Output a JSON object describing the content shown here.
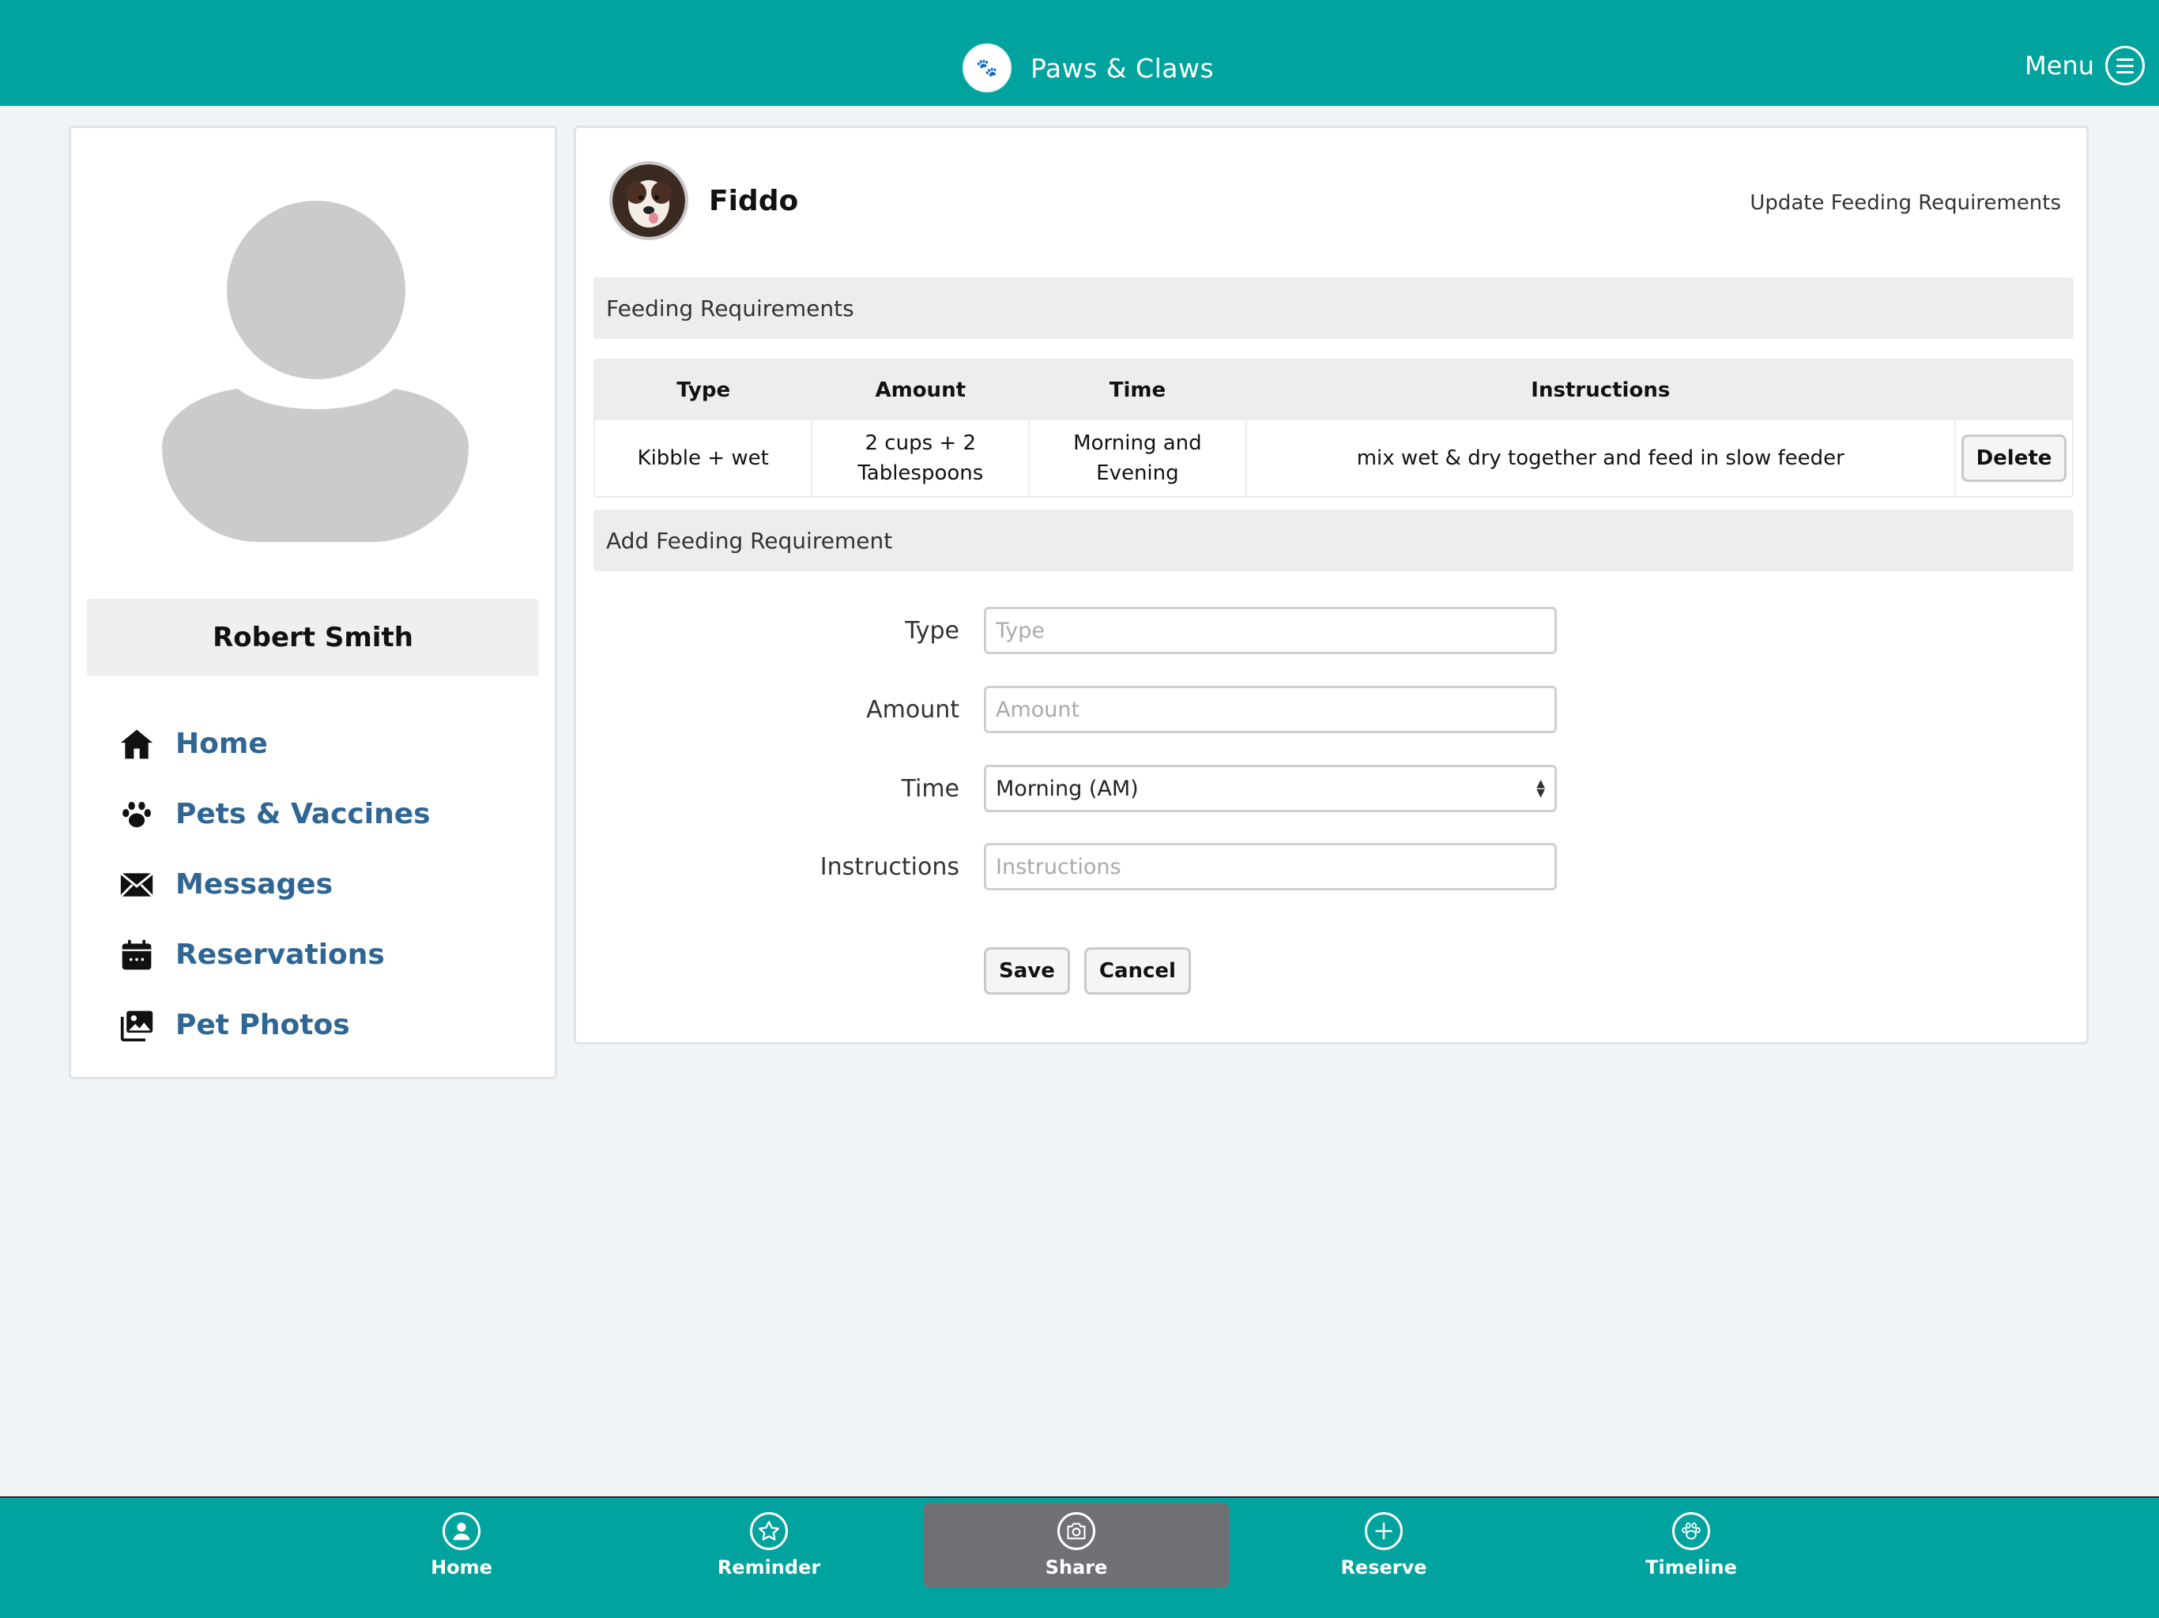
{
  "header": {
    "app_name": "Paws & Claws",
    "logo_text": "🐾",
    "menu_label": "Menu"
  },
  "sidebar": {
    "user_name": "Robert Smith",
    "items": [
      {
        "label": "Home",
        "icon": "home-icon"
      },
      {
        "label": "Pets & Vaccines",
        "icon": "paw-icon"
      },
      {
        "label": "Messages",
        "icon": "envelope-icon"
      },
      {
        "label": "Reservations",
        "icon": "calendar-icon"
      },
      {
        "label": "Pet Photos",
        "icon": "photos-icon"
      }
    ]
  },
  "main": {
    "pet_name": "Fiddo",
    "update_link": "Update Feeding Requirements",
    "feeding_section_title": "Feeding Requirements",
    "table": {
      "headers": [
        "Type",
        "Amount",
        "Time",
        "Instructions"
      ],
      "rows": [
        {
          "type": "Kibble + wet",
          "amount": "2 cups + 2 Tablespoons",
          "time": "Morning and Evening",
          "instructions": "mix wet & dry together and feed in slow feeder",
          "action": "Delete"
        }
      ]
    },
    "add_section_title": "Add Feeding Requirement",
    "form": {
      "type_label": "Type",
      "type_placeholder": "Type",
      "amount_label": "Amount",
      "amount_placeholder": "Amount",
      "time_label": "Time",
      "time_value": "Morning (AM)",
      "instructions_label": "Instructions",
      "instructions_placeholder": "Instructions",
      "save_label": "Save",
      "cancel_label": "Cancel"
    }
  },
  "bottom_nav": [
    {
      "label": "Home",
      "icon": "user-circle-icon"
    },
    {
      "label": "Reminder",
      "icon": "star-icon"
    },
    {
      "label": "Share",
      "icon": "camera-icon",
      "active": true
    },
    {
      "label": "Reserve",
      "icon": "plus-icon"
    },
    {
      "label": "Timeline",
      "icon": "paw-icon"
    }
  ],
  "colors": {
    "brand": "#00a39e",
    "link": "#2f6694",
    "page_bg": "#f1f4f6",
    "active_tab": "#6f7175"
  }
}
